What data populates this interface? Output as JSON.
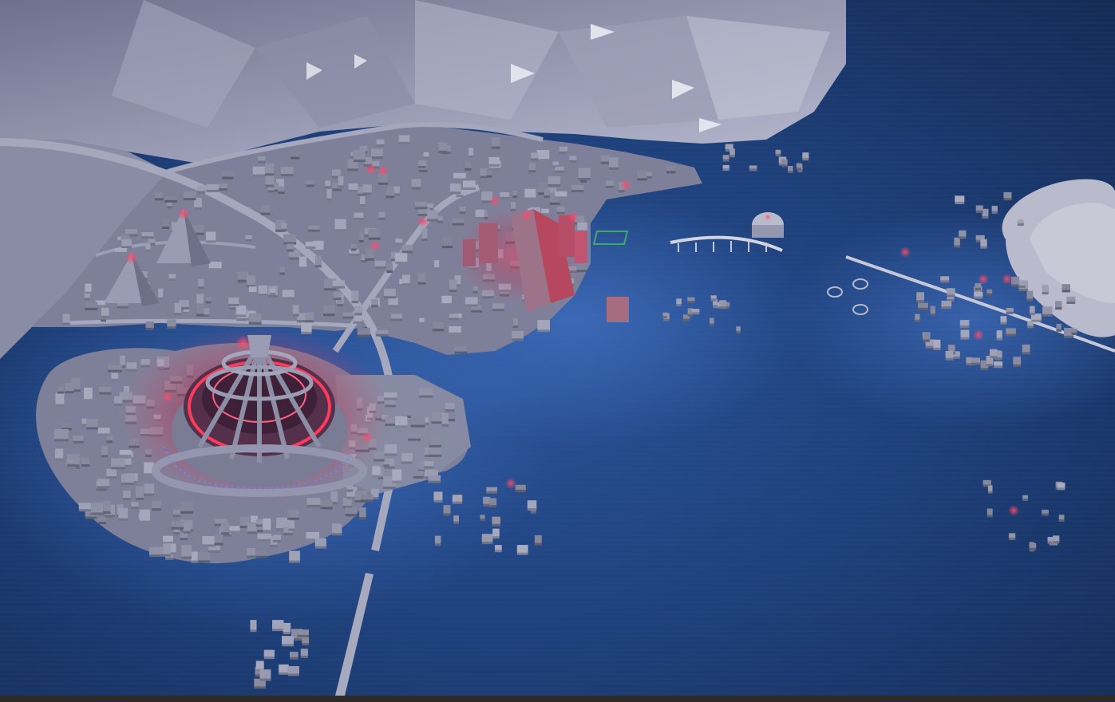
{
  "scene": {
    "kind": "isometric-city-map",
    "theme": "night",
    "colors": {
      "water": "#1e3f78",
      "water_deep": "#17315f",
      "water_glow": "#3d6fc4",
      "land": "#7e809a",
      "land_light": "#9fa1b8",
      "building": "#8c8ea6",
      "building_shadow": "#5c5e76",
      "road": "#a5a7bc",
      "mountain": "#8e90ab",
      "mountain_light": "#b3b5cb",
      "red_light": "#ff3a5c",
      "blue_light": "#5d8dff",
      "green_accent": "#3da86a",
      "bottom_strip": "#2b2b2b"
    },
    "landmarks": [
      {
        "id": "dome-arena",
        "description_icon": "glowing-dome-icon"
      },
      {
        "id": "twin-pyramids",
        "description_icon": "pyramid-icon"
      },
      {
        "id": "central-tower",
        "description_icon": "tower-icon"
      },
      {
        "id": "observatory-dome",
        "description_icon": "dome-icon"
      },
      {
        "id": "long-bridge",
        "description_icon": "bridge-icon"
      },
      {
        "id": "harbor-pier",
        "description_icon": "pier-icon"
      }
    ]
  }
}
